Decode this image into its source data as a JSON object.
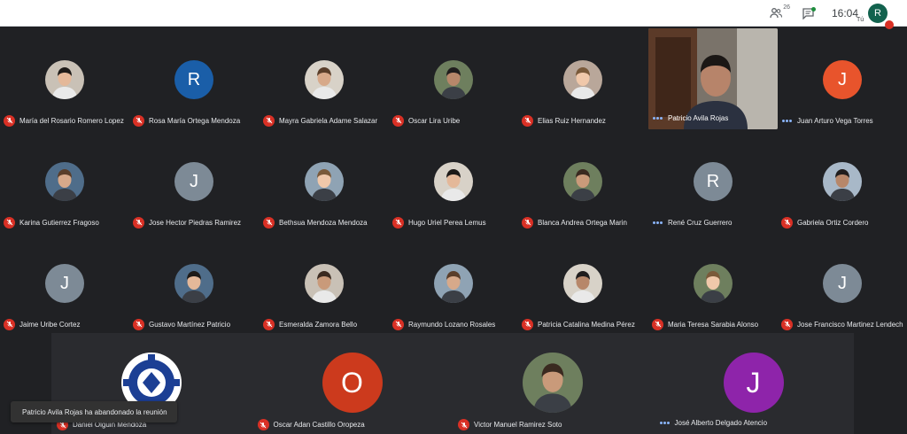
{
  "topbar": {
    "participants_count": "26",
    "time": "16:04",
    "self_initial": "R",
    "self_label": "Tú"
  },
  "colors": {
    "background": "#202124",
    "mute_red": "#d93025",
    "speaking_blue": "#8ab4f8"
  },
  "rows": [
    [
      {
        "name": "María del Rosario Romero Lopez",
        "avatar": "photo",
        "muted": true
      },
      {
        "name": "Rosa María Ortega Mendoza",
        "avatar": "R",
        "color": "#1a5ea8",
        "muted": true
      },
      {
        "name": "Mayra Gabriela Adame Salazar",
        "avatar": "photo",
        "muted": true
      },
      {
        "name": "Oscar Lira Uribe",
        "avatar": "photo",
        "muted": true
      },
      {
        "name": "Elias Ruiz Hernandez",
        "avatar": "photo",
        "muted": true
      },
      {
        "name": "Patricio Avila Rojas",
        "avatar": "video",
        "muted": false
      },
      {
        "name": "Juan Arturo Vega Torres",
        "avatar": "J",
        "color": "#e8542c",
        "muted": false
      }
    ],
    [
      {
        "name": "Karina Gutierrez Fragoso",
        "avatar": "photo",
        "muted": true
      },
      {
        "name": "Jose Hector Piedras Ramirez",
        "avatar": "J",
        "color": "#7d8a96",
        "muted": true
      },
      {
        "name": "Bethsua Mendoza Mendoza",
        "avatar": "photo",
        "muted": true
      },
      {
        "name": "Hugo Uriel Perea Lemus",
        "avatar": "photo",
        "muted": true
      },
      {
        "name": "Blanca Andrea Ortega Marin",
        "avatar": "photo",
        "muted": true
      },
      {
        "name": "René Cruz Guerrero",
        "avatar": "R",
        "color": "#7d8a96",
        "muted": false
      },
      {
        "name": "Gabriela Ortiz Cordero",
        "avatar": "photo",
        "muted": true
      }
    ],
    [
      {
        "name": "Jaime Uribe Cortez",
        "avatar": "J",
        "color": "#7d8a96",
        "muted": true
      },
      {
        "name": "Gustavo Martínez Patricio",
        "avatar": "photo",
        "muted": true
      },
      {
        "name": "Esmeralda Zamora Bello",
        "avatar": "photo",
        "muted": true
      },
      {
        "name": "Raymundo Lozano Rosales",
        "avatar": "photo",
        "muted": true
      },
      {
        "name": "Patricia Catalina Medina Pérez",
        "avatar": "photo",
        "muted": true
      },
      {
        "name": "Maria Teresa Sarabia Alonso",
        "avatar": "photo",
        "muted": true
      },
      {
        "name": "Jose Francisco Martinez Lendech",
        "avatar": "J",
        "color": "#7d8a96",
        "muted": true
      }
    ]
  ],
  "bottom": [
    {
      "name": "Daniel Olguin Mendoza",
      "avatar": "logo",
      "muted": true
    },
    {
      "name": "Oscar Adan Castillo Oropeza",
      "avatar": "O",
      "color": "#cc3a1d",
      "muted": true
    },
    {
      "name": "Victor Manuel Ramirez Soto",
      "avatar": "photo",
      "muted": true
    },
    {
      "name": "José Alberto Delgado Atencio",
      "avatar": "J",
      "color": "#8e24aa",
      "muted": false
    }
  ],
  "toast": "Patricio Avila Rojas ha abandonado la reunión"
}
